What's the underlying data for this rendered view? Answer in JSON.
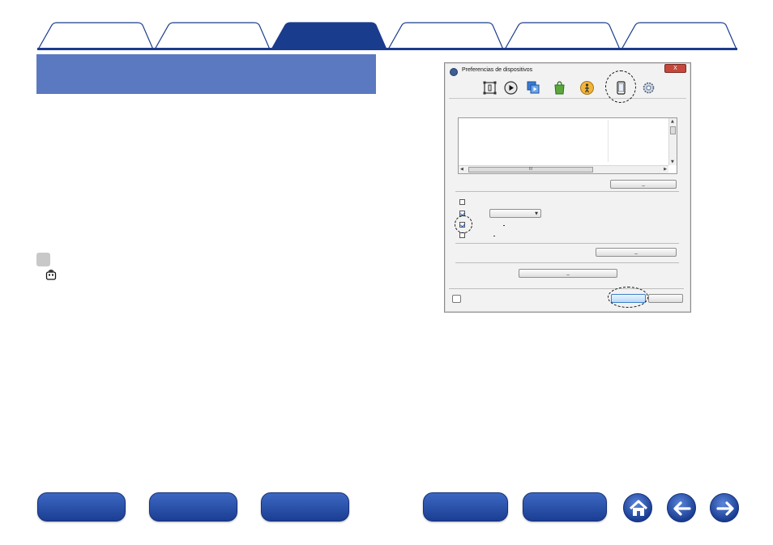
{
  "tabs": [
    {
      "label": "",
      "active": false
    },
    {
      "label": "",
      "active": false
    },
    {
      "label": "",
      "active": true
    },
    {
      "label": "",
      "active": false
    },
    {
      "label": "",
      "active": false
    },
    {
      "label": "",
      "active": false
    }
  ],
  "colors": {
    "tab_active": "#1a3c8c",
    "tab_inactive": "#ffffff",
    "section_header": "#5b79c0",
    "nav_button": "#1f4299"
  },
  "section_header": {
    "title": ""
  },
  "dialog": {
    "title": "Preferencias de dispositivos",
    "close_label": "X",
    "toolbar_icons": [
      "bracket-icon",
      "play-icon",
      "copy-icon",
      "bag-icon",
      "person-icon",
      "phone-icon",
      "gear-icon"
    ],
    "selected_toolbar_icon": "phone-icon",
    "hscroll_grip": "III",
    "remove_label": "_",
    "checkboxes": [
      {
        "checked": false
      },
      {
        "checked": true
      },
      {
        "checked": true
      },
      {
        "checked": false
      }
    ],
    "select_value": "",
    "path_button_label": "_",
    "bottom_button_label": "_",
    "ok_label": "",
    "cancel_label": ""
  },
  "bottom_nav": {
    "buttons": [
      "",
      "",
      "",
      "",
      ""
    ],
    "icons": [
      "home-icon",
      "back-arrow-icon",
      "forward-arrow-icon"
    ]
  }
}
